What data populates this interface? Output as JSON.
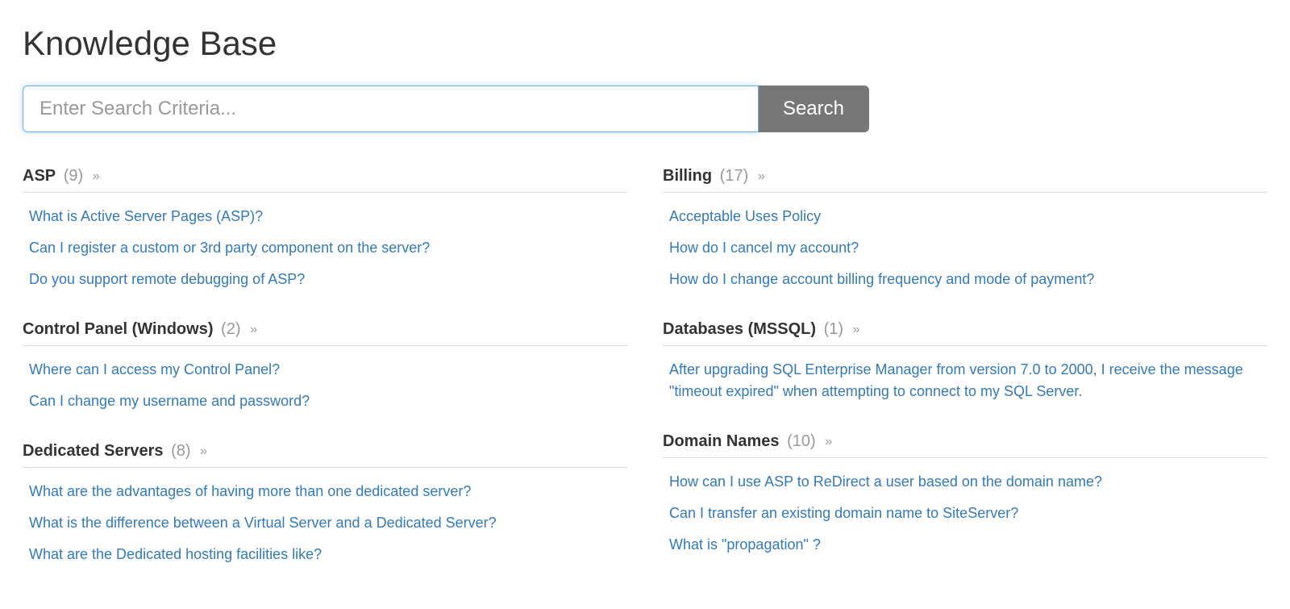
{
  "page": {
    "title": "Knowledge Base"
  },
  "search": {
    "placeholder": "Enter Search Criteria...",
    "value": "",
    "button_label": "Search"
  },
  "left_categories": [
    {
      "name": "ASP",
      "count": "(9)",
      "articles": [
        "What is Active Server Pages (ASP)?",
        "Can I register a custom or 3rd party component on the server?",
        "Do you support remote debugging of ASP?"
      ]
    },
    {
      "name": "Control Panel (Windows)",
      "count": "(2)",
      "articles": [
        "Where can I access my Control Panel?",
        "Can I change my username and password?"
      ]
    },
    {
      "name": "Dedicated Servers",
      "count": "(8)",
      "articles": [
        "What are the advantages of having more than one dedicated server?",
        "What is the difference between a Virtual Server and a Dedicated Server?",
        "What are the Dedicated hosting facilities like?"
      ]
    }
  ],
  "right_categories": [
    {
      "name": "Billing",
      "count": "(17)",
      "articles": [
        "Acceptable Uses Policy",
        "How do I cancel my account?",
        "How do I change account billing frequency and mode of payment?"
      ]
    },
    {
      "name": "Databases (MSSQL)",
      "count": "(1)",
      "articles": [
        "After upgrading SQL Enterprise Manager from version 7.0 to 2000, I receive the message \"timeout expired\" when attempting to connect to my SQL Server."
      ]
    },
    {
      "name": "Domain Names",
      "count": "(10)",
      "articles": [
        "How can I use ASP to ReDirect a user based on the domain name?",
        "Can I transfer an existing domain name to SiteServer?",
        "What is \"propagation\" ?"
      ]
    }
  ]
}
